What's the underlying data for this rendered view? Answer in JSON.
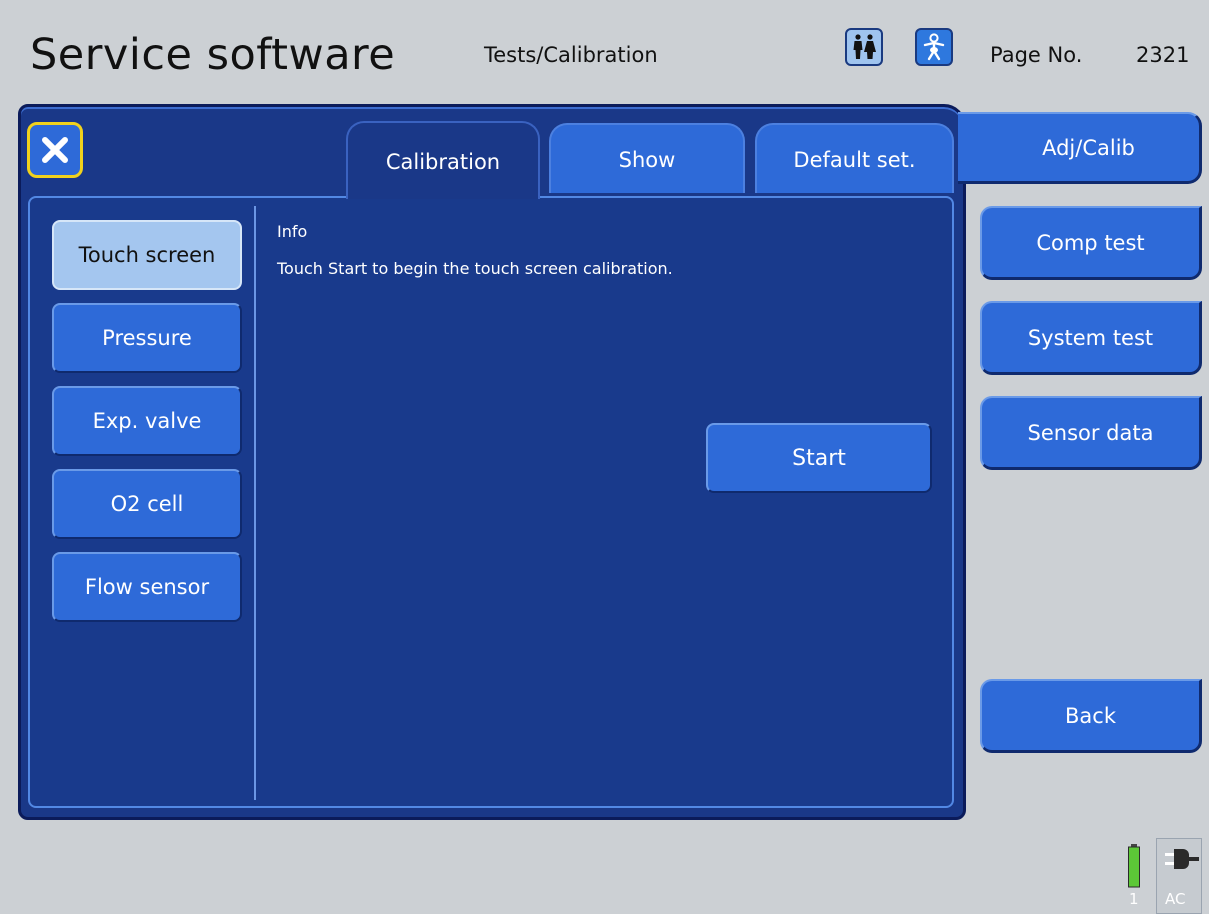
{
  "header": {
    "app_title": "Service software",
    "section": "Tests/Calibration",
    "page_no_label": "Page No.",
    "page_no": "2321",
    "patient_adult_icon": "adult-patient-icon",
    "patient_infant_icon": "infant-patient-icon"
  },
  "panel": {
    "close_icon": "close-icon",
    "tabs": [
      {
        "label": "Calibration",
        "selected": true
      },
      {
        "label": "Show",
        "selected": false
      },
      {
        "label": "Default set.",
        "selected": false
      }
    ],
    "side_items": [
      {
        "label": "Touch screen",
        "selected": true
      },
      {
        "label": "Pressure",
        "selected": false
      },
      {
        "label": "Exp. valve",
        "selected": false
      },
      {
        "label": "O2 cell",
        "selected": false
      },
      {
        "label": "Flow sensor",
        "selected": false
      }
    ],
    "info_title": "Info",
    "info_text": "Touch Start to begin the touch screen calibration.",
    "start_label": "Start"
  },
  "nav": {
    "items": [
      {
        "label": "Adj/Calib",
        "selected": true
      },
      {
        "label": "Comp test",
        "selected": false
      },
      {
        "label": "System test",
        "selected": false
      },
      {
        "label": "Sensor data",
        "selected": false
      }
    ],
    "back_label": "Back"
  },
  "status": {
    "battery_number": "1",
    "power_label": "AC",
    "battery_icon": "battery-icon",
    "plug_icon": "plug-icon"
  },
  "colors": {
    "panel": "#1a3888",
    "button": "#2e6ad8",
    "selected_button": "#a4c6ef",
    "close_border": "#f1d21c",
    "background": "#ccd0d4"
  }
}
